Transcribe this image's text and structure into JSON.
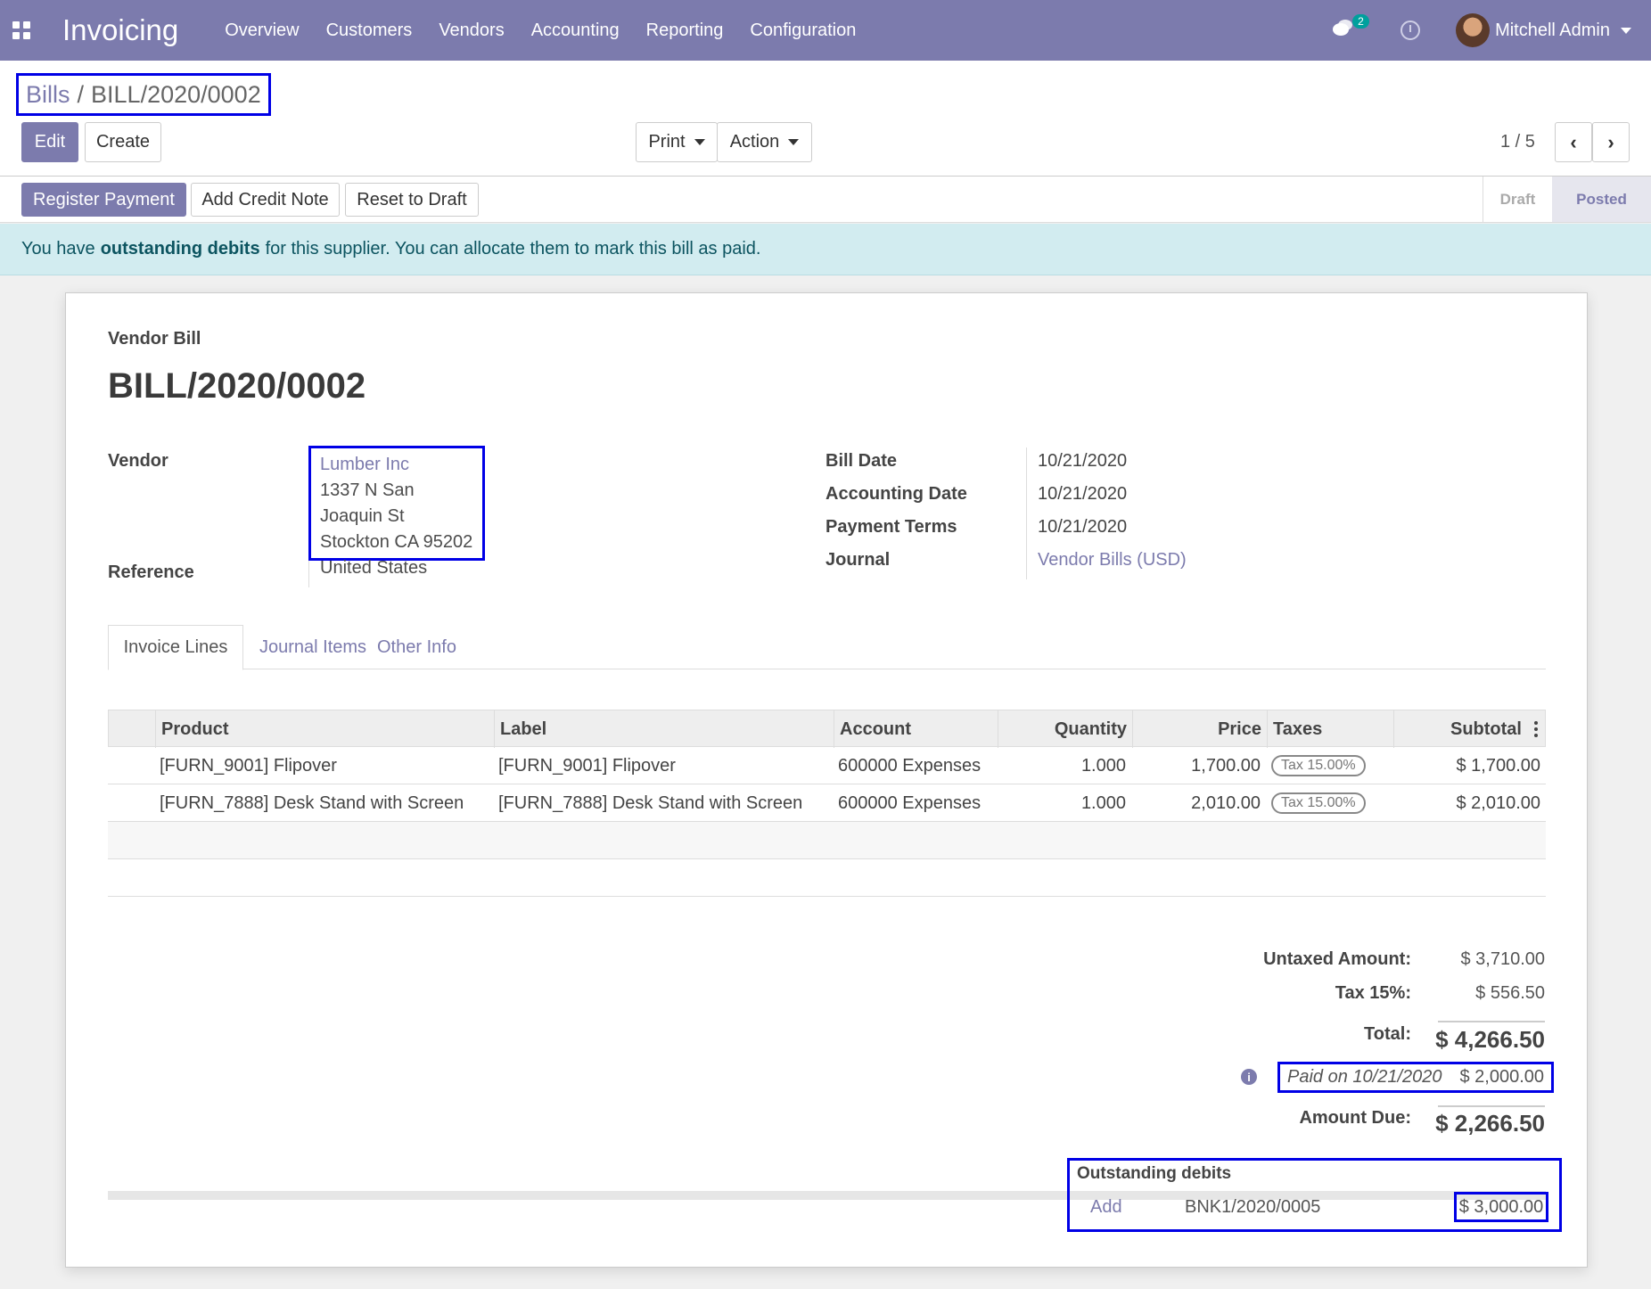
{
  "navbar": {
    "app_title": "Invoicing",
    "menu": [
      "Overview",
      "Customers",
      "Vendors",
      "Accounting",
      "Reporting",
      "Configuration"
    ],
    "message_count": "2",
    "user_name": "Mitchell Admin"
  },
  "breadcrumb": {
    "parent": "Bills",
    "separator": "/",
    "current": "BILL/2020/0002"
  },
  "buttons": {
    "edit": "Edit",
    "create": "Create",
    "print": "Print",
    "action": "Action"
  },
  "pager": {
    "text": "1 / 5"
  },
  "status_actions": {
    "register_payment": "Register Payment",
    "add_credit_note": "Add Credit Note",
    "reset_to_draft": "Reset to Draft"
  },
  "statusbar": {
    "draft": "Draft",
    "posted": "Posted",
    "active": "Posted"
  },
  "alert": {
    "before": "You have",
    "bold": "outstanding debits",
    "after": "for this supplier. You can allocate them to mark this bill as paid."
  },
  "sheet": {
    "subtitle": "Vendor Bill",
    "title": "BILL/2020/0002",
    "vendor_label": "Vendor",
    "vendor": {
      "name": "Lumber Inc",
      "street": "1337 N San Joaquin St",
      "city": "Stockton CA 95202",
      "country": "United States"
    },
    "reference_label": "Reference",
    "bill_date_label": "Bill Date",
    "bill_date": "10/21/2020",
    "accounting_date_label": "Accounting Date",
    "accounting_date": "10/21/2020",
    "payment_terms_label": "Payment Terms",
    "payment_terms": "10/21/2020",
    "journal_label": "Journal",
    "journal": "Vendor Bills (USD)"
  },
  "tabs": [
    "Invoice Lines",
    "Journal Items",
    "Other Info"
  ],
  "table": {
    "headers": {
      "product": "Product",
      "label": "Label",
      "account": "Account",
      "quantity": "Quantity",
      "price": "Price",
      "taxes": "Taxes",
      "subtotal": "Subtotal"
    },
    "rows": [
      {
        "product": "[FURN_9001] Flipover",
        "label": "[FURN_9001] Flipover",
        "account": "600000 Expenses",
        "quantity": "1.000",
        "price": "1,700.00",
        "tax": "Tax 15.00%",
        "subtotal": "$ 1,700.00"
      },
      {
        "product": "[FURN_7888] Desk Stand with Screen",
        "label": "[FURN_7888] Desk Stand with Screen",
        "account": "600000 Expenses",
        "quantity": "1.000",
        "price": "2,010.00",
        "tax": "Tax 15.00%",
        "subtotal": "$ 2,010.00"
      }
    ]
  },
  "totals": {
    "untaxed_label": "Untaxed Amount:",
    "untaxed": "$ 3,710.00",
    "tax_label": "Tax 15%:",
    "tax": "$ 556.50",
    "total_label": "Total:",
    "total": "$ 4,266.50",
    "paid_label": "Paid on 10/21/2020",
    "paid": "$ 2,000.00",
    "due_label": "Amount Due:",
    "due": "$ 2,266.50"
  },
  "outstanding": {
    "title": "Outstanding debits",
    "add": "Add",
    "ref": "BNK1/2020/0005",
    "amount": "$ 3,000.00"
  },
  "colors": {
    "brand": "#7c7bad",
    "alert_bg": "#d2ecf0",
    "highlight_border": "#0000e6"
  }
}
